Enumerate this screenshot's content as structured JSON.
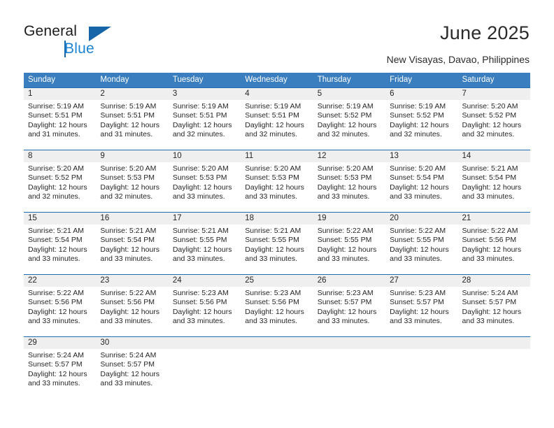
{
  "brand": {
    "name_part1": "General",
    "name_part2": "Blue",
    "accent_color": "#1b84d6",
    "triangle_color": "#1565a8"
  },
  "header": {
    "title": "June 2025",
    "location": "New Visayas, Davao, Philippines"
  },
  "calendar": {
    "header_bg": "#3a7ebf",
    "daynum_bg": "#efefef",
    "separator_color": "#1f6bb0",
    "weekdays": [
      "Sunday",
      "Monday",
      "Tuesday",
      "Wednesday",
      "Thursday",
      "Friday",
      "Saturday"
    ],
    "weeks": [
      [
        {
          "day": "1",
          "sunrise": "Sunrise: 5:19 AM",
          "sunset": "Sunset: 5:51 PM",
          "daylight1": "Daylight: 12 hours",
          "daylight2": "and 31 minutes."
        },
        {
          "day": "2",
          "sunrise": "Sunrise: 5:19 AM",
          "sunset": "Sunset: 5:51 PM",
          "daylight1": "Daylight: 12 hours",
          "daylight2": "and 31 minutes."
        },
        {
          "day": "3",
          "sunrise": "Sunrise: 5:19 AM",
          "sunset": "Sunset: 5:51 PM",
          "daylight1": "Daylight: 12 hours",
          "daylight2": "and 32 minutes."
        },
        {
          "day": "4",
          "sunrise": "Sunrise: 5:19 AM",
          "sunset": "Sunset: 5:51 PM",
          "daylight1": "Daylight: 12 hours",
          "daylight2": "and 32 minutes."
        },
        {
          "day": "5",
          "sunrise": "Sunrise: 5:19 AM",
          "sunset": "Sunset: 5:52 PM",
          "daylight1": "Daylight: 12 hours",
          "daylight2": "and 32 minutes."
        },
        {
          "day": "6",
          "sunrise": "Sunrise: 5:19 AM",
          "sunset": "Sunset: 5:52 PM",
          "daylight1": "Daylight: 12 hours",
          "daylight2": "and 32 minutes."
        },
        {
          "day": "7",
          "sunrise": "Sunrise: 5:20 AM",
          "sunset": "Sunset: 5:52 PM",
          "daylight1": "Daylight: 12 hours",
          "daylight2": "and 32 minutes."
        }
      ],
      [
        {
          "day": "8",
          "sunrise": "Sunrise: 5:20 AM",
          "sunset": "Sunset: 5:52 PM",
          "daylight1": "Daylight: 12 hours",
          "daylight2": "and 32 minutes."
        },
        {
          "day": "9",
          "sunrise": "Sunrise: 5:20 AM",
          "sunset": "Sunset: 5:53 PM",
          "daylight1": "Daylight: 12 hours",
          "daylight2": "and 32 minutes."
        },
        {
          "day": "10",
          "sunrise": "Sunrise: 5:20 AM",
          "sunset": "Sunset: 5:53 PM",
          "daylight1": "Daylight: 12 hours",
          "daylight2": "and 33 minutes."
        },
        {
          "day": "11",
          "sunrise": "Sunrise: 5:20 AM",
          "sunset": "Sunset: 5:53 PM",
          "daylight1": "Daylight: 12 hours",
          "daylight2": "and 33 minutes."
        },
        {
          "day": "12",
          "sunrise": "Sunrise: 5:20 AM",
          "sunset": "Sunset: 5:53 PM",
          "daylight1": "Daylight: 12 hours",
          "daylight2": "and 33 minutes."
        },
        {
          "day": "13",
          "sunrise": "Sunrise: 5:20 AM",
          "sunset": "Sunset: 5:54 PM",
          "daylight1": "Daylight: 12 hours",
          "daylight2": "and 33 minutes."
        },
        {
          "day": "14",
          "sunrise": "Sunrise: 5:21 AM",
          "sunset": "Sunset: 5:54 PM",
          "daylight1": "Daylight: 12 hours",
          "daylight2": "and 33 minutes."
        }
      ],
      [
        {
          "day": "15",
          "sunrise": "Sunrise: 5:21 AM",
          "sunset": "Sunset: 5:54 PM",
          "daylight1": "Daylight: 12 hours",
          "daylight2": "and 33 minutes."
        },
        {
          "day": "16",
          "sunrise": "Sunrise: 5:21 AM",
          "sunset": "Sunset: 5:54 PM",
          "daylight1": "Daylight: 12 hours",
          "daylight2": "and 33 minutes."
        },
        {
          "day": "17",
          "sunrise": "Sunrise: 5:21 AM",
          "sunset": "Sunset: 5:55 PM",
          "daylight1": "Daylight: 12 hours",
          "daylight2": "and 33 minutes."
        },
        {
          "day": "18",
          "sunrise": "Sunrise: 5:21 AM",
          "sunset": "Sunset: 5:55 PM",
          "daylight1": "Daylight: 12 hours",
          "daylight2": "and 33 minutes."
        },
        {
          "day": "19",
          "sunrise": "Sunrise: 5:22 AM",
          "sunset": "Sunset: 5:55 PM",
          "daylight1": "Daylight: 12 hours",
          "daylight2": "and 33 minutes."
        },
        {
          "day": "20",
          "sunrise": "Sunrise: 5:22 AM",
          "sunset": "Sunset: 5:55 PM",
          "daylight1": "Daylight: 12 hours",
          "daylight2": "and 33 minutes."
        },
        {
          "day": "21",
          "sunrise": "Sunrise: 5:22 AM",
          "sunset": "Sunset: 5:56 PM",
          "daylight1": "Daylight: 12 hours",
          "daylight2": "and 33 minutes."
        }
      ],
      [
        {
          "day": "22",
          "sunrise": "Sunrise: 5:22 AM",
          "sunset": "Sunset: 5:56 PM",
          "daylight1": "Daylight: 12 hours",
          "daylight2": "and 33 minutes."
        },
        {
          "day": "23",
          "sunrise": "Sunrise: 5:22 AM",
          "sunset": "Sunset: 5:56 PM",
          "daylight1": "Daylight: 12 hours",
          "daylight2": "and 33 minutes."
        },
        {
          "day": "24",
          "sunrise": "Sunrise: 5:23 AM",
          "sunset": "Sunset: 5:56 PM",
          "daylight1": "Daylight: 12 hours",
          "daylight2": "and 33 minutes."
        },
        {
          "day": "25",
          "sunrise": "Sunrise: 5:23 AM",
          "sunset": "Sunset: 5:56 PM",
          "daylight1": "Daylight: 12 hours",
          "daylight2": "and 33 minutes."
        },
        {
          "day": "26",
          "sunrise": "Sunrise: 5:23 AM",
          "sunset": "Sunset: 5:57 PM",
          "daylight1": "Daylight: 12 hours",
          "daylight2": "and 33 minutes."
        },
        {
          "day": "27",
          "sunrise": "Sunrise: 5:23 AM",
          "sunset": "Sunset: 5:57 PM",
          "daylight1": "Daylight: 12 hours",
          "daylight2": "and 33 minutes."
        },
        {
          "day": "28",
          "sunrise": "Sunrise: 5:24 AM",
          "sunset": "Sunset: 5:57 PM",
          "daylight1": "Daylight: 12 hours",
          "daylight2": "and 33 minutes."
        }
      ],
      [
        {
          "day": "29",
          "sunrise": "Sunrise: 5:24 AM",
          "sunset": "Sunset: 5:57 PM",
          "daylight1": "Daylight: 12 hours",
          "daylight2": "and 33 minutes."
        },
        {
          "day": "30",
          "sunrise": "Sunrise: 5:24 AM",
          "sunset": "Sunset: 5:57 PM",
          "daylight1": "Daylight: 12 hours",
          "daylight2": "and 33 minutes."
        },
        {
          "day": "",
          "sunrise": "",
          "sunset": "",
          "daylight1": "",
          "daylight2": ""
        },
        {
          "day": "",
          "sunrise": "",
          "sunset": "",
          "daylight1": "",
          "daylight2": ""
        },
        {
          "day": "",
          "sunrise": "",
          "sunset": "",
          "daylight1": "",
          "daylight2": ""
        },
        {
          "day": "",
          "sunrise": "",
          "sunset": "",
          "daylight1": "",
          "daylight2": ""
        },
        {
          "day": "",
          "sunrise": "",
          "sunset": "",
          "daylight1": "",
          "daylight2": ""
        }
      ]
    ]
  }
}
